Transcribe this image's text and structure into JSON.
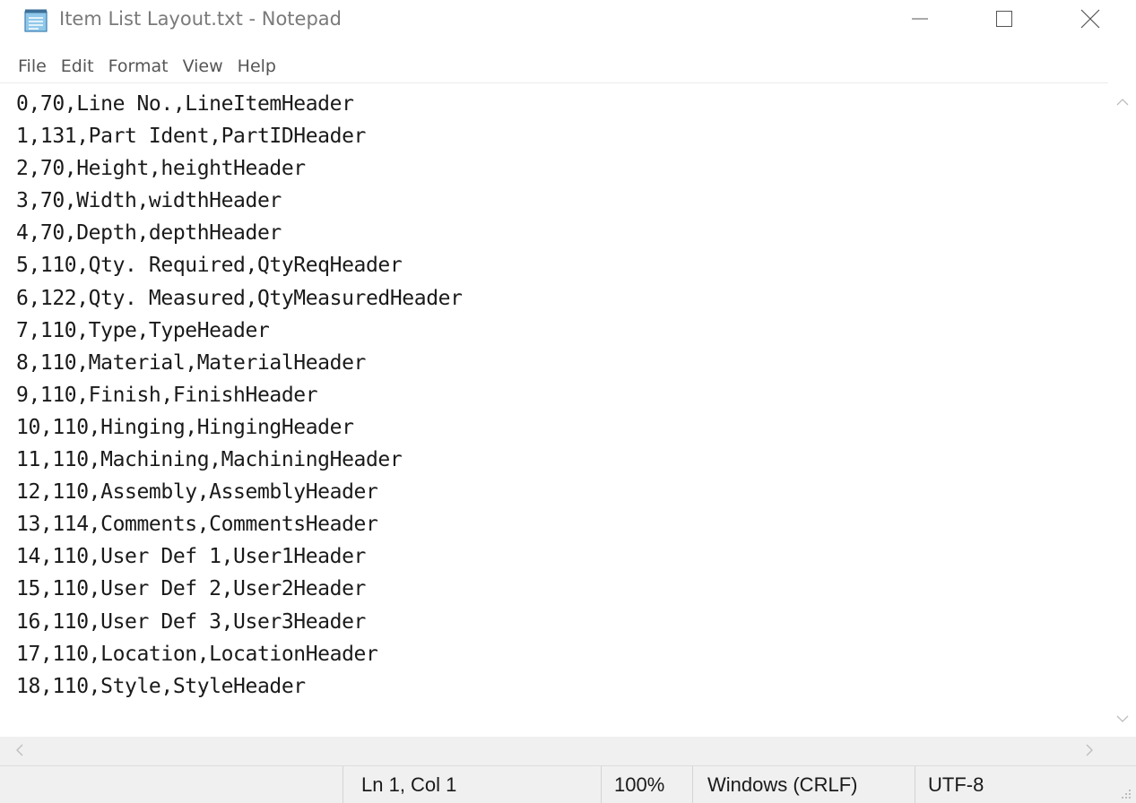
{
  "window": {
    "title": "Item List Layout.txt - Notepad",
    "icon": "notepad-icon"
  },
  "title_buttons": {
    "minimize_icon": "minimize-icon",
    "maximize_icon": "maximize-icon",
    "close_icon": "close-icon"
  },
  "menu": {
    "items": [
      {
        "label": "File"
      },
      {
        "label": "Edit"
      },
      {
        "label": "Format"
      },
      {
        "label": "View"
      },
      {
        "label": "Help"
      }
    ]
  },
  "editor": {
    "lines": [
      "0,70,Line No.,LineItemHeader",
      "1,131,Part Ident,PartIDHeader",
      "2,70,Height,heightHeader",
      "3,70,Width,widthHeader",
      "4,70,Depth,depthHeader",
      "5,110,Qty. Required,QtyReqHeader",
      "6,122,Qty. Measured,QtyMeasuredHeader",
      "7,110,Type,TypeHeader",
      "8,110,Material,MaterialHeader",
      "9,110,Finish,FinishHeader",
      "10,110,Hinging,HingingHeader",
      "11,110,Machining,MachiningHeader",
      "12,110,Assembly,AssemblyHeader",
      "13,114,Comments,CommentsHeader",
      "14,110,User Def 1,User1Header",
      "15,110,User Def 2,User2Header",
      "16,110,User Def 3,User3Header",
      "17,110,Location,LocationHeader",
      "18,110,Style,StyleHeader"
    ]
  },
  "status": {
    "position": "Ln 1, Col 1",
    "zoom": "100%",
    "line_ending": "Windows (CRLF)",
    "encoding": "UTF-8"
  },
  "colors": {
    "background": "#ffffff",
    "chrome": "#f0f0f0",
    "title_text": "#7a7a7a",
    "text": "#1a1a1a"
  }
}
